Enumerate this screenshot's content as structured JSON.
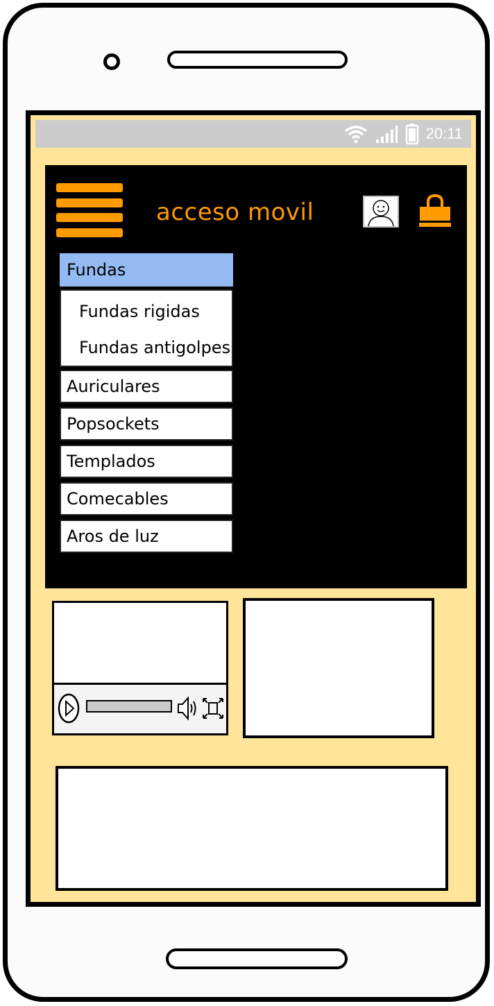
{
  "status_bar": {
    "time": "20:11",
    "icons": [
      "wifi-icon",
      "signal-icon",
      "battery-icon"
    ]
  },
  "header": {
    "title": "acceso movil",
    "menu_icon": "hamburger-menu-icon",
    "profile_icon": "avatar-icon",
    "cart_icon": "shopping-bag-icon"
  },
  "menu": {
    "selected": {
      "label": "Fundas"
    },
    "subitems": [
      {
        "label": "Fundas rigidas"
      },
      {
        "label": "Fundas antigolpes"
      }
    ],
    "items": [
      {
        "label": "Auriculares"
      },
      {
        "label": "Popsockets"
      },
      {
        "label": "Templados"
      },
      {
        "label": "Comecables"
      },
      {
        "label": "Aros de luz"
      }
    ]
  },
  "video": {
    "controls": [
      "play-icon",
      "volume-icon",
      "fullscreen-icon"
    ]
  },
  "colors": {
    "accent": "#ff9a00",
    "background": "#ffe49a",
    "selected": "#93baf2",
    "panel": "#000000",
    "status_bar": "#cccccc"
  }
}
